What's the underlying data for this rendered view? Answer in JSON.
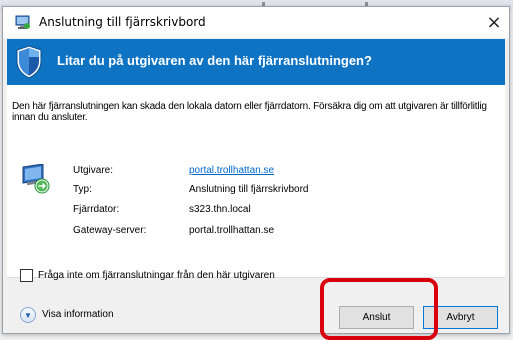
{
  "window": {
    "title": "Anslutning till fjärrskrivbord",
    "close_label": "×"
  },
  "banner": {
    "heading": "Litar du på utgivaren av den här fjärranslutningen?",
    "background": "#0f73c4"
  },
  "warning": {
    "text": "Den här fjärranslutningen kan skada den lokala datorn eller fjärrdatorn. Försäkra dig om att utgivaren är tillförlitlig innan du ansluter."
  },
  "details": {
    "rows": [
      {
        "label": "Utgivare:",
        "value": "portal.trollhattan.se",
        "is_link": true
      },
      {
        "label": "Typ:",
        "value": "Anslutning till fjärrskrivbord",
        "is_link": false
      },
      {
        "label": "Fjärrdator:",
        "value": "s323.thn.local",
        "is_link": false
      },
      {
        "label": "Gateway-server:",
        "value": "portal.trollhattan.se",
        "is_link": false
      }
    ]
  },
  "checkbox": {
    "label": "Fråga inte om fjärranslutningar från den här utgivaren",
    "checked": false
  },
  "show_info": {
    "label": "Visa information",
    "icon": "chevron-down-icon"
  },
  "buttons": {
    "connect_label": "Anslut",
    "cancel_label": "Avbryt"
  },
  "annotation": {
    "color": "#d9000d"
  }
}
